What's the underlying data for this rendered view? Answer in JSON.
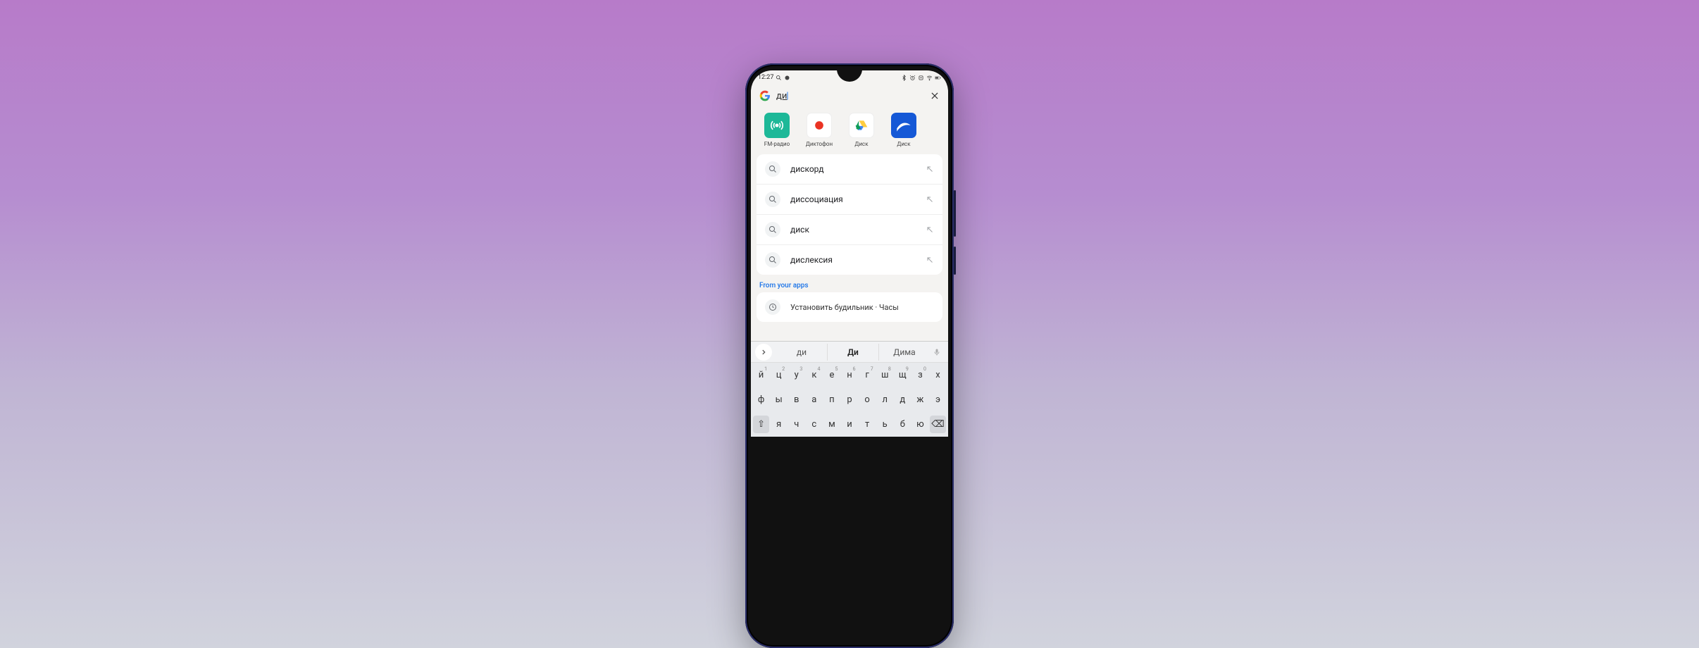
{
  "status": {
    "time": "12:27"
  },
  "search": {
    "query": "ди"
  },
  "apps": [
    {
      "label": "FM-радио"
    },
    {
      "label": "Диктофон"
    },
    {
      "label": "Диск"
    },
    {
      "label": "Диск"
    }
  ],
  "suggestions": [
    {
      "text": "дискорд"
    },
    {
      "text": "диссоциация"
    },
    {
      "text": "диск"
    },
    {
      "text": "дислексия"
    }
  ],
  "section_label": "From your apps",
  "app_result": "Установить будильник · Часы",
  "keyboard": {
    "suggest": [
      "ди",
      "Ди",
      "Дима"
    ],
    "rows": [
      [
        {
          "k": "й",
          "n": "1"
        },
        {
          "k": "ц",
          "n": "2"
        },
        {
          "k": "у",
          "n": "3"
        },
        {
          "k": "к",
          "n": "4"
        },
        {
          "k": "е",
          "n": "5"
        },
        {
          "k": "н",
          "n": "6"
        },
        {
          "k": "г",
          "n": "7"
        },
        {
          "k": "ш",
          "n": "8"
        },
        {
          "k": "щ",
          "n": "9"
        },
        {
          "k": "з",
          "n": "0"
        },
        {
          "k": "х",
          "n": ""
        }
      ],
      [
        {
          "k": "ф"
        },
        {
          "k": "ы"
        },
        {
          "k": "в"
        },
        {
          "k": "а"
        },
        {
          "k": "п"
        },
        {
          "k": "р"
        },
        {
          "k": "о"
        },
        {
          "k": "л"
        },
        {
          "k": "д"
        },
        {
          "k": "ж"
        },
        {
          "k": "э"
        }
      ],
      [
        {
          "k": "⇧",
          "special": true
        },
        {
          "k": "я"
        },
        {
          "k": "ч"
        },
        {
          "k": "с"
        },
        {
          "k": "м"
        },
        {
          "k": "и"
        },
        {
          "k": "т"
        },
        {
          "k": "ь"
        },
        {
          "k": "б"
        },
        {
          "k": "ю"
        },
        {
          "k": "⌫",
          "special": true
        }
      ]
    ]
  }
}
